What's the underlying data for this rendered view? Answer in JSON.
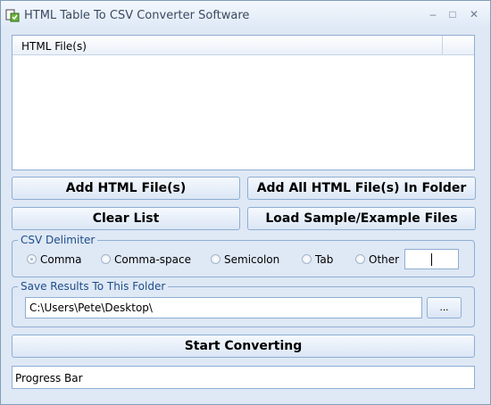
{
  "window": {
    "title": "HTML Table To CSV Converter Software",
    "minimize": "–",
    "maximize": "□",
    "close": "✕"
  },
  "file_list": {
    "header": "HTML File(s)"
  },
  "buttons": {
    "add_files": "Add HTML File(s)",
    "add_folder": "Add All HTML File(s) In Folder",
    "clear_list": "Clear List",
    "load_samples": "Load Sample/Example Files",
    "start": "Start Converting",
    "browse": "..."
  },
  "csv_delimiter": {
    "label": "CSV Delimiter",
    "options": [
      {
        "label": "Comma",
        "checked": true
      },
      {
        "label": "Comma-space",
        "checked": false
      },
      {
        "label": "Semicolon",
        "checked": false
      },
      {
        "label": "Tab",
        "checked": false
      },
      {
        "label": "Other",
        "checked": false
      }
    ],
    "other_value": ""
  },
  "save_folder": {
    "label": "Save Results To This Folder",
    "path": "C:\\Users\\Pete\\Desktop\\"
  },
  "progress": {
    "text": "Progress Bar"
  }
}
